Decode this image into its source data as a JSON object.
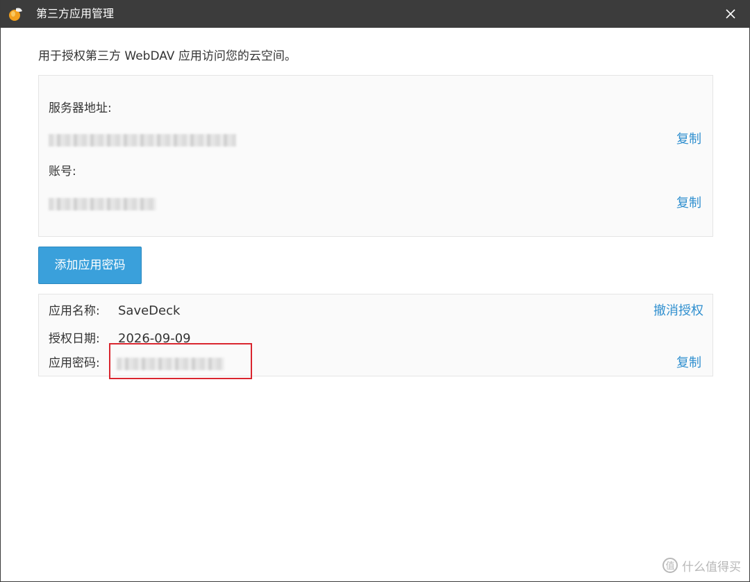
{
  "window": {
    "title": "第三方应用管理"
  },
  "intro_text": "用于授权第三方 WebDAV 应用访问您的云空间。",
  "server_panel": {
    "server_label": "服务器地址:",
    "account_label": "账号:",
    "copy_label": "复制"
  },
  "add_button_label": "添加应用密码",
  "app_entry": {
    "name_label": "应用名称:",
    "name_value": "SaveDeck",
    "revoke_label": "撤消授权",
    "date_label": "授权日期:",
    "date_value": "2026-09-09",
    "password_label": "应用密码:",
    "copy_label": "复制"
  },
  "watermark": {
    "text": "什么值得买"
  },
  "colors": {
    "titlebar": "#3c3c3c",
    "link": "#2f8fcf",
    "button": "#3aa0db",
    "highlight": "#d9252e"
  }
}
